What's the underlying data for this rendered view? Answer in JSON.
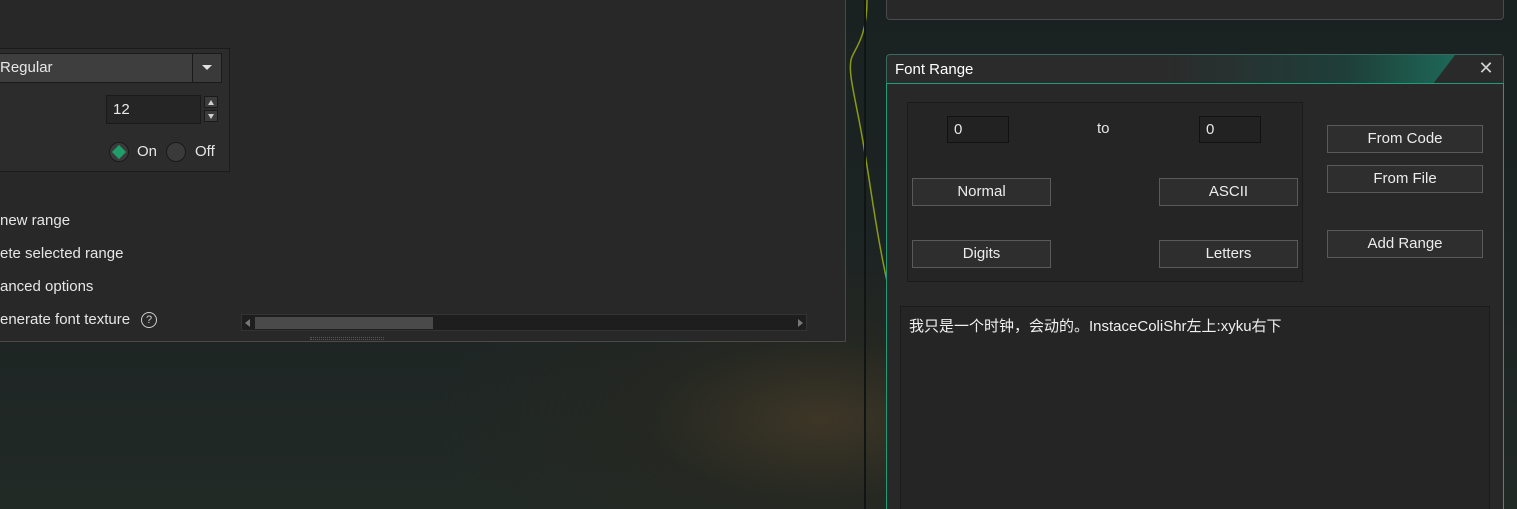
{
  "left_panel": {
    "style_dropdown": {
      "value": "Regular"
    },
    "size_input": {
      "value": "12"
    },
    "antialias": {
      "on_label": "On",
      "off_label": "Off",
      "selected": "On"
    },
    "actions": [
      {
        "label": "new range"
      },
      {
        "label": "ete selected range"
      },
      {
        "label": "anced options"
      },
      {
        "label": "enerate font texture"
      }
    ],
    "help_icon_glyph": "?"
  },
  "font_range": {
    "title": "Font Range",
    "close_glyph": "✕",
    "from_value": "0",
    "to_label": "to",
    "to_value": "0",
    "presets": {
      "normal": "Normal",
      "ascii": "ASCII",
      "digits": "Digits",
      "letters": "Letters"
    },
    "side_buttons": {
      "from_code": "From Code",
      "from_file": "From File",
      "add_range": "Add Range"
    },
    "text_content": "我只是一个时钟，会动的。InstaceColiShr左上:xyku右下"
  },
  "colors": {
    "accent": "#1f9d78",
    "curve": "#8a9a16"
  }
}
